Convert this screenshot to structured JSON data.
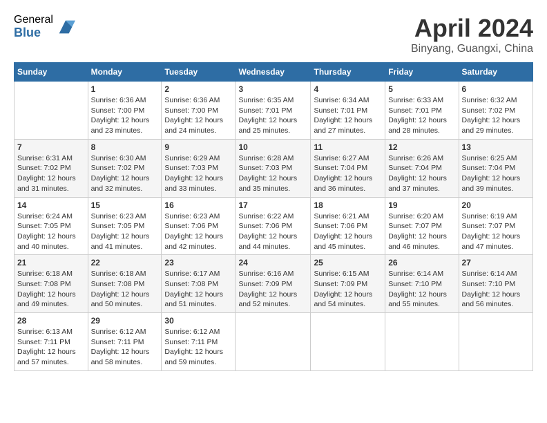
{
  "header": {
    "logo_general": "General",
    "logo_blue": "Blue",
    "month_title": "April 2024",
    "subtitle": "Binyang, Guangxi, China"
  },
  "weekdays": [
    "Sunday",
    "Monday",
    "Tuesday",
    "Wednesday",
    "Thursday",
    "Friday",
    "Saturday"
  ],
  "weeks": [
    [
      {
        "day": "",
        "sunrise": "",
        "sunset": "",
        "daylight": ""
      },
      {
        "day": "1",
        "sunrise": "Sunrise: 6:36 AM",
        "sunset": "Sunset: 7:00 PM",
        "daylight": "Daylight: 12 hours and 23 minutes."
      },
      {
        "day": "2",
        "sunrise": "Sunrise: 6:36 AM",
        "sunset": "Sunset: 7:00 PM",
        "daylight": "Daylight: 12 hours and 24 minutes."
      },
      {
        "day": "3",
        "sunrise": "Sunrise: 6:35 AM",
        "sunset": "Sunset: 7:01 PM",
        "daylight": "Daylight: 12 hours and 25 minutes."
      },
      {
        "day": "4",
        "sunrise": "Sunrise: 6:34 AM",
        "sunset": "Sunset: 7:01 PM",
        "daylight": "Daylight: 12 hours and 27 minutes."
      },
      {
        "day": "5",
        "sunrise": "Sunrise: 6:33 AM",
        "sunset": "Sunset: 7:01 PM",
        "daylight": "Daylight: 12 hours and 28 minutes."
      },
      {
        "day": "6",
        "sunrise": "Sunrise: 6:32 AM",
        "sunset": "Sunset: 7:02 PM",
        "daylight": "Daylight: 12 hours and 29 minutes."
      }
    ],
    [
      {
        "day": "7",
        "sunrise": "Sunrise: 6:31 AM",
        "sunset": "Sunset: 7:02 PM",
        "daylight": "Daylight: 12 hours and 31 minutes."
      },
      {
        "day": "8",
        "sunrise": "Sunrise: 6:30 AM",
        "sunset": "Sunset: 7:02 PM",
        "daylight": "Daylight: 12 hours and 32 minutes."
      },
      {
        "day": "9",
        "sunrise": "Sunrise: 6:29 AM",
        "sunset": "Sunset: 7:03 PM",
        "daylight": "Daylight: 12 hours and 33 minutes."
      },
      {
        "day": "10",
        "sunrise": "Sunrise: 6:28 AM",
        "sunset": "Sunset: 7:03 PM",
        "daylight": "Daylight: 12 hours and 35 minutes."
      },
      {
        "day": "11",
        "sunrise": "Sunrise: 6:27 AM",
        "sunset": "Sunset: 7:04 PM",
        "daylight": "Daylight: 12 hours and 36 minutes."
      },
      {
        "day": "12",
        "sunrise": "Sunrise: 6:26 AM",
        "sunset": "Sunset: 7:04 PM",
        "daylight": "Daylight: 12 hours and 37 minutes."
      },
      {
        "day": "13",
        "sunrise": "Sunrise: 6:25 AM",
        "sunset": "Sunset: 7:04 PM",
        "daylight": "Daylight: 12 hours and 39 minutes."
      }
    ],
    [
      {
        "day": "14",
        "sunrise": "Sunrise: 6:24 AM",
        "sunset": "Sunset: 7:05 PM",
        "daylight": "Daylight: 12 hours and 40 minutes."
      },
      {
        "day": "15",
        "sunrise": "Sunrise: 6:23 AM",
        "sunset": "Sunset: 7:05 PM",
        "daylight": "Daylight: 12 hours and 41 minutes."
      },
      {
        "day": "16",
        "sunrise": "Sunrise: 6:23 AM",
        "sunset": "Sunset: 7:06 PM",
        "daylight": "Daylight: 12 hours and 42 minutes."
      },
      {
        "day": "17",
        "sunrise": "Sunrise: 6:22 AM",
        "sunset": "Sunset: 7:06 PM",
        "daylight": "Daylight: 12 hours and 44 minutes."
      },
      {
        "day": "18",
        "sunrise": "Sunrise: 6:21 AM",
        "sunset": "Sunset: 7:06 PM",
        "daylight": "Daylight: 12 hours and 45 minutes."
      },
      {
        "day": "19",
        "sunrise": "Sunrise: 6:20 AM",
        "sunset": "Sunset: 7:07 PM",
        "daylight": "Daylight: 12 hours and 46 minutes."
      },
      {
        "day": "20",
        "sunrise": "Sunrise: 6:19 AM",
        "sunset": "Sunset: 7:07 PM",
        "daylight": "Daylight: 12 hours and 47 minutes."
      }
    ],
    [
      {
        "day": "21",
        "sunrise": "Sunrise: 6:18 AM",
        "sunset": "Sunset: 7:08 PM",
        "daylight": "Daylight: 12 hours and 49 minutes."
      },
      {
        "day": "22",
        "sunrise": "Sunrise: 6:18 AM",
        "sunset": "Sunset: 7:08 PM",
        "daylight": "Daylight: 12 hours and 50 minutes."
      },
      {
        "day": "23",
        "sunrise": "Sunrise: 6:17 AM",
        "sunset": "Sunset: 7:08 PM",
        "daylight": "Daylight: 12 hours and 51 minutes."
      },
      {
        "day": "24",
        "sunrise": "Sunrise: 6:16 AM",
        "sunset": "Sunset: 7:09 PM",
        "daylight": "Daylight: 12 hours and 52 minutes."
      },
      {
        "day": "25",
        "sunrise": "Sunrise: 6:15 AM",
        "sunset": "Sunset: 7:09 PM",
        "daylight": "Daylight: 12 hours and 54 minutes."
      },
      {
        "day": "26",
        "sunrise": "Sunrise: 6:14 AM",
        "sunset": "Sunset: 7:10 PM",
        "daylight": "Daylight: 12 hours and 55 minutes."
      },
      {
        "day": "27",
        "sunrise": "Sunrise: 6:14 AM",
        "sunset": "Sunset: 7:10 PM",
        "daylight": "Daylight: 12 hours and 56 minutes."
      }
    ],
    [
      {
        "day": "28",
        "sunrise": "Sunrise: 6:13 AM",
        "sunset": "Sunset: 7:11 PM",
        "daylight": "Daylight: 12 hours and 57 minutes."
      },
      {
        "day": "29",
        "sunrise": "Sunrise: 6:12 AM",
        "sunset": "Sunset: 7:11 PM",
        "daylight": "Daylight: 12 hours and 58 minutes."
      },
      {
        "day": "30",
        "sunrise": "Sunrise: 6:12 AM",
        "sunset": "Sunset: 7:11 PM",
        "daylight": "Daylight: 12 hours and 59 minutes."
      },
      {
        "day": "",
        "sunrise": "",
        "sunset": "",
        "daylight": ""
      },
      {
        "day": "",
        "sunrise": "",
        "sunset": "",
        "daylight": ""
      },
      {
        "day": "",
        "sunrise": "",
        "sunset": "",
        "daylight": ""
      },
      {
        "day": "",
        "sunrise": "",
        "sunset": "",
        "daylight": ""
      }
    ]
  ]
}
